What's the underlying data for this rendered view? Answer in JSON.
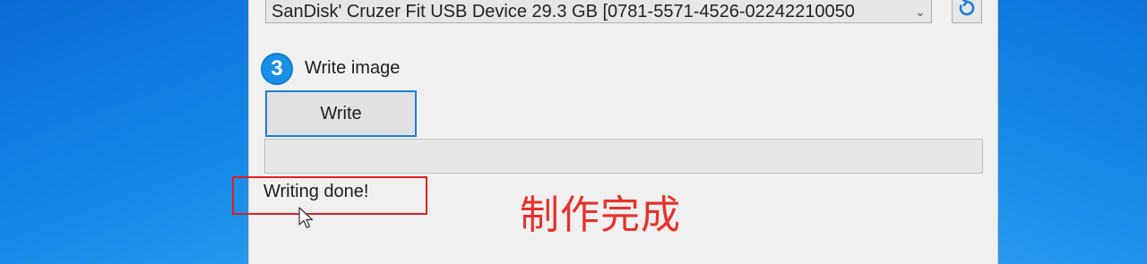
{
  "device": {
    "selected": "SanDisk' Cruzer Fit USB Device 29.3 GB [0781-5571-4526-02242210050",
    "chevron_icon": "chevron-down-icon",
    "refresh_icon": "refresh-icon"
  },
  "step": {
    "number": "3",
    "title": "Write image",
    "badge_color": "#1a8fe5"
  },
  "write_button": {
    "label": "Write",
    "border_color": "#1a7fd9"
  },
  "progress": {
    "value": 0
  },
  "status": {
    "text": "Writing done!"
  },
  "annotation": {
    "text": "制作完成",
    "color": "#e8312b",
    "box_color": "#e02020"
  }
}
